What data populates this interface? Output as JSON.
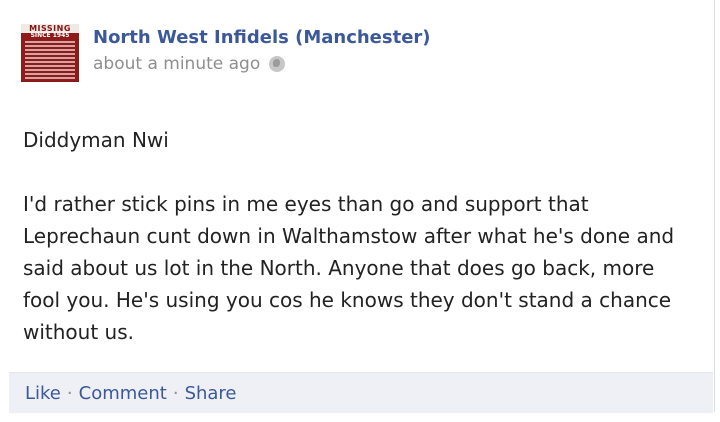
{
  "post": {
    "page_name": "North West Infidels (Manchester)",
    "timestamp": "about a minute ago",
    "audience_icon": "globe-icon",
    "avatar": {
      "banner_text": "MISSING",
      "since_text": "SINCE 1945"
    },
    "author_line": "Diddyman Nwi",
    "message": "I'd rather stick pins in me eyes than go and support that Leprechaun cunt down in Walthamstow after what he's done and said about us lot in the North. Anyone that does go back, more fool you. He's using you cos he knows they don't stand a chance without us."
  },
  "actions": {
    "like": "Like",
    "comment": "Comment",
    "share": "Share",
    "separator": "·"
  },
  "colors": {
    "link": "#3b5998",
    "meta": "#8e8e8e",
    "action_bar": "#eef0f5",
    "avatar": "#8e1a1a"
  }
}
